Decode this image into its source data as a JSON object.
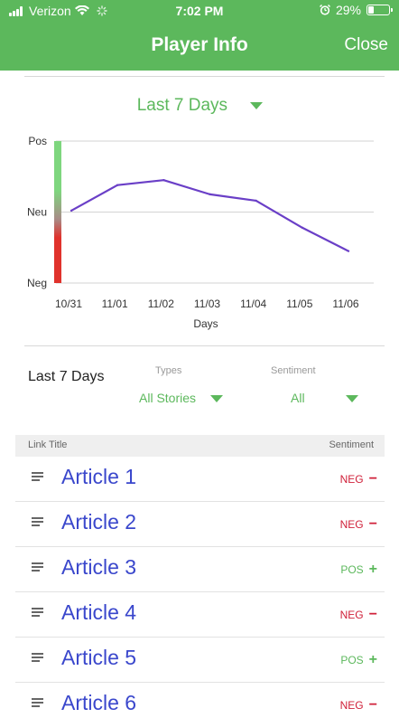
{
  "status_bar": {
    "carrier": "Verizon",
    "time": "7:02 PM",
    "battery": "29%",
    "battery_level": 0.29
  },
  "nav": {
    "title": "Player Info",
    "close_label": "Close"
  },
  "range_selector": {
    "label": "Last 7 Days"
  },
  "chart_data": {
    "type": "line",
    "x": [
      "10/31",
      "11/01",
      "11/02",
      "11/03",
      "11/04",
      "11/05",
      "11/06"
    ],
    "y_levels": [
      "Neg",
      "Neu",
      "Pos"
    ],
    "series": [
      {
        "values": [
          0.02,
          0.38,
          0.45,
          0.25,
          0.16,
          -0.22,
          -0.55
        ],
        "color": "#6a3fc7"
      }
    ],
    "xlabel": "Days",
    "ylim": [
      -1,
      1
    ],
    "grid": true,
    "gradient_colors": {
      "pos": "#7ed67e",
      "neu": "#a88b87",
      "neg": "#e0322c"
    }
  },
  "filters": {
    "period": "Last 7 Days",
    "types_label": "Types",
    "types_value": "All Stories",
    "sentiment_label": "Sentiment",
    "sentiment_value": "All"
  },
  "list": {
    "header_left": "Link Title",
    "header_right": "Sentiment",
    "colors": {
      "neg": "#d0213a",
      "pos": "#5cb85c"
    },
    "rows": [
      {
        "title": "Article 1",
        "sentiment": "NEG",
        "sign": "−"
      },
      {
        "title": "Article 2",
        "sentiment": "NEG",
        "sign": "−"
      },
      {
        "title": "Article 3",
        "sentiment": "POS",
        "sign": "+"
      },
      {
        "title": "Article 4",
        "sentiment": "NEG",
        "sign": "−"
      },
      {
        "title": "Article 5",
        "sentiment": "POS",
        "sign": "+"
      },
      {
        "title": "Article 6",
        "sentiment": "NEG",
        "sign": "−"
      }
    ]
  }
}
